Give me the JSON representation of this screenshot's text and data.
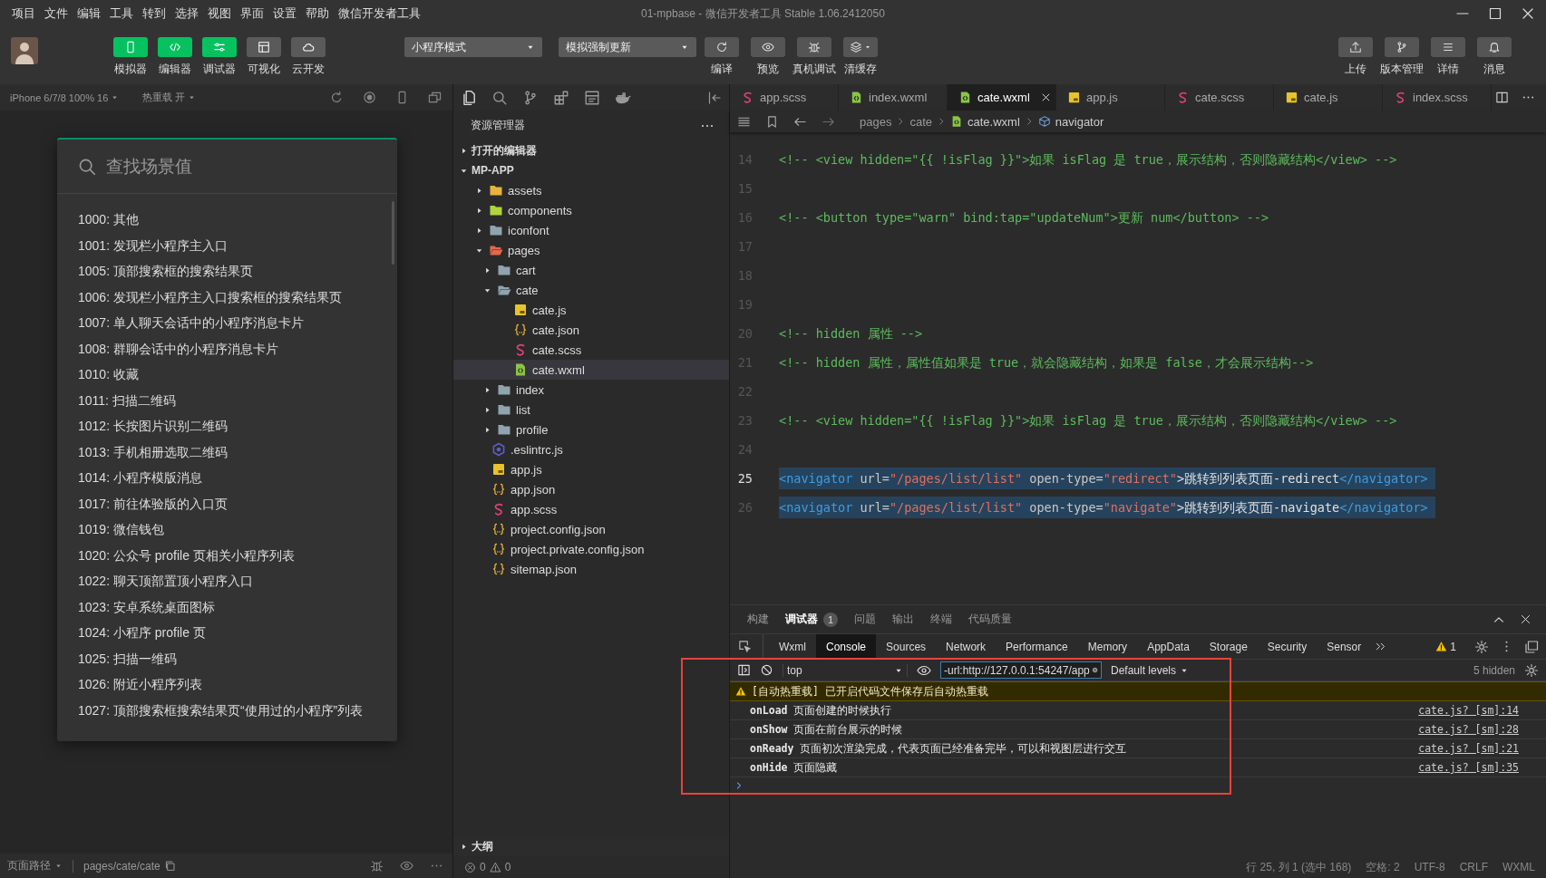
{
  "menu_bar": {
    "items": [
      "项目",
      "文件",
      "编辑",
      "工具",
      "转到",
      "选择",
      "视图",
      "界面",
      "设置",
      "帮助",
      "微信开发者工具"
    ]
  },
  "window": {
    "title": "01-mpbase - 微信开发者工具 Stable 1.06.2412050"
  },
  "toolbar": {
    "panel_toggles": [
      {
        "label": "模拟器",
        "selected": true
      },
      {
        "label": "编辑器",
        "selected": true
      },
      {
        "label": "调试器",
        "selected": true
      },
      {
        "label": "可视化",
        "selected": false
      },
      {
        "label": "云开发",
        "selected": false
      }
    ],
    "mode_select": "小程序模式",
    "compile_select": "模拟强制更新",
    "actions": [
      "编译",
      "预览",
      "真机调试",
      "清缓存"
    ],
    "right_actions": [
      "上传",
      "版本管理",
      "详情",
      "消息"
    ]
  },
  "simulator": {
    "device": "iPhone 6/7/8 100% 16",
    "hot_reload": "热重载 开",
    "search": {
      "placeholder": "查找场景值"
    },
    "scenes": [
      "1000: 其他",
      "1001: 发现栏小程序主入口",
      "1005: 顶部搜索框的搜索结果页",
      "1006: 发现栏小程序主入口搜索框的搜索结果页",
      "1007: 单人聊天会话中的小程序消息卡片",
      "1008: 群聊会话中的小程序消息卡片",
      "1010: 收藏",
      "1011: 扫描二维码",
      "1012: 长按图片识别二维码",
      "1013: 手机相册选取二维码",
      "1014: 小程序模版消息",
      "1017: 前往体验版的入口页",
      "1019: 微信钱包",
      "1020: 公众号 profile 页相关小程序列表",
      "1022: 聊天顶部置顶小程序入口",
      "1023: 安卓系统桌面图标",
      "1024: 小程序 profile 页",
      "1025: 扫描一维码",
      "1026: 附近小程序列表",
      "1027: 顶部搜索框搜索结果页“使用过的小程序”列表"
    ],
    "page_path": {
      "label": "页面路径",
      "path": "pages/cate/cate"
    }
  },
  "explorer": {
    "title": "资源管理器",
    "open_editors": {
      "label": "打开的编辑器",
      "expanded": false
    },
    "project": {
      "label": "MP-APP",
      "expanded": true,
      "children": [
        {
          "name": "assets",
          "kind": "folder",
          "color": "#e8b43c",
          "expanded": false,
          "selected": false
        },
        {
          "name": "components",
          "kind": "folder",
          "color": "#b4d23c",
          "expanded": false,
          "selected": false
        },
        {
          "name": "iconfont",
          "kind": "folder",
          "color": "#90a4ae",
          "expanded": false,
          "selected": false
        },
        {
          "name": "pages",
          "kind": "folder",
          "color": "#e2694a",
          "expanded": true,
          "selected": false,
          "children": [
            {
              "name": "cart",
              "kind": "folder",
              "color": "#90a4ae",
              "expanded": false,
              "selected": false
            },
            {
              "name": "cate",
              "kind": "folder",
              "color": "#90a4ae",
              "expanded": true,
              "selected": false,
              "children": [
                {
                  "name": "cate.js",
                  "kind": "js",
                  "selected": false
                },
                {
                  "name": "cate.json",
                  "kind": "json",
                  "selected": false
                },
                {
                  "name": "cate.scss",
                  "kind": "scss",
                  "selected": false
                },
                {
                  "name": "cate.wxml",
                  "kind": "wxml",
                  "selected": true
                }
              ]
            },
            {
              "name": "index",
              "kind": "folder",
              "color": "#90a4ae",
              "expanded": false,
              "selected": false
            },
            {
              "name": "list",
              "kind": "folder",
              "color": "#90a4ae",
              "expanded": false,
              "selected": false
            },
            {
              "name": "profile",
              "kind": "folder",
              "color": "#90a4ae",
              "expanded": false,
              "selected": false
            }
          ]
        },
        {
          "name": ".eslintrc.js",
          "kind": "eslint",
          "selected": false
        },
        {
          "name": "app.js",
          "kind": "js",
          "selected": false
        },
        {
          "name": "app.json",
          "kind": "json",
          "selected": false
        },
        {
          "name": "app.scss",
          "kind": "scss",
          "selected": false
        },
        {
          "name": "project.config.json",
          "kind": "json",
          "selected": false
        },
        {
          "name": "project.private.config.json",
          "kind": "json",
          "selected": false
        },
        {
          "name": "sitemap.json",
          "kind": "json",
          "selected": false
        }
      ]
    },
    "outline": {
      "label": "大纲",
      "expanded": false
    },
    "problems": {
      "errors": "0",
      "warnings": "0"
    }
  },
  "editor": {
    "tabs": [
      {
        "label": "app.scss",
        "kind": "scss",
        "selected": false
      },
      {
        "label": "index.wxml",
        "kind": "wxml",
        "selected": false
      },
      {
        "label": "cate.wxml",
        "kind": "wxml",
        "selected": true
      },
      {
        "label": "app.js",
        "kind": "js",
        "selected": false
      },
      {
        "label": "cate.scss",
        "kind": "scss",
        "selected": false
      },
      {
        "label": "cate.js",
        "kind": "js",
        "selected": false
      },
      {
        "label": "index.scss",
        "kind": "scss",
        "selected": false
      }
    ],
    "breadcrumb": [
      {
        "label": "pages",
        "kind": "folder"
      },
      {
        "label": "cate",
        "kind": "folder"
      },
      {
        "label": "cate.wxml",
        "kind": "wxml"
      },
      {
        "label": "navigator",
        "kind": "element"
      }
    ],
    "lines": [
      {
        "number": "14",
        "current": false,
        "selected": false,
        "tokens": [
          {
            "kind": "comment",
            "text": "<!-- <view hidden=\"{{ !isFlag }}\">如果 isFlag 是 true，展示结构，否则隐藏结构</view> -->"
          }
        ]
      },
      {
        "number": "15",
        "current": false,
        "selected": false
      },
      {
        "number": "16",
        "current": false,
        "selected": false,
        "tokens": [
          {
            "kind": "comment",
            "text": "<!-- <button type=\"warn\" bind:tap=\"updateNum\">更新 num</button> -->"
          }
        ]
      },
      {
        "number": "17",
        "current": false,
        "selected": false
      },
      {
        "number": "18",
        "current": false,
        "selected": false
      },
      {
        "number": "19",
        "current": false,
        "selected": false
      },
      {
        "number": "20",
        "current": false,
        "selected": false,
        "tokens": [
          {
            "kind": "comment",
            "text": "<!-- hidden 属性 -->"
          }
        ]
      },
      {
        "number": "21",
        "current": false,
        "selected": false,
        "tokens": [
          {
            "kind": "comment",
            "text": "<!-- hidden 属性，属性值如果是 true，就会隐藏结构，如果是 false，才会展示结构-->"
          }
        ]
      },
      {
        "number": "22",
        "current": false,
        "selected": false
      },
      {
        "number": "23",
        "current": false,
        "selected": false,
        "tokens": [
          {
            "kind": "comment",
            "text": "<!-- <view hidden=\"{{ !isFlag }}\">如果 isFlag 是 true，展示结构，否则隐藏结构</view> -->"
          }
        ]
      },
      {
        "number": "24",
        "current": false,
        "selected": false
      },
      {
        "number": "25",
        "current": true,
        "selected": true,
        "tokens": [
          {
            "kind": "tag",
            "text": "<navigator"
          },
          {
            "kind": "attr",
            "text": " url="
          },
          {
            "kind": "string",
            "text": "\"/pages/list/list\""
          },
          {
            "kind": "attr",
            "text": " open-type="
          },
          {
            "kind": "string",
            "text": "\"redirect\""
          },
          {
            "kind": "text",
            "text": ">跳转到列表页面-redirect"
          },
          {
            "kind": "tag",
            "text": "</navigator>"
          }
        ]
      },
      {
        "number": "26",
        "current": false,
        "selected": true,
        "tokens": [
          {
            "kind": "tag",
            "text": "<navigator"
          },
          {
            "kind": "attr",
            "text": " url="
          },
          {
            "kind": "string",
            "text": "\"/pages/list/list\""
          },
          {
            "kind": "attr",
            "text": " open-type="
          },
          {
            "kind": "string",
            "text": "\"navigate\""
          },
          {
            "kind": "text",
            "text": ">跳转到列表页面-navigate"
          },
          {
            "kind": "tag",
            "text": "</navigator>"
          }
        ]
      }
    ]
  },
  "panel": {
    "tabs": [
      {
        "label": "构建",
        "selected": false
      },
      {
        "label": "调试器",
        "selected": true,
        "badge": "1"
      },
      {
        "label": "问题",
        "selected": false
      },
      {
        "label": "输出",
        "selected": false
      },
      {
        "label": "终端",
        "selected": false
      },
      {
        "label": "代码质量",
        "selected": false
      }
    ],
    "devtools": {
      "tabs": [
        {
          "label": "Wxml",
          "selected": false
        },
        {
          "label": "Console",
          "selected": true
        },
        {
          "label": "Sources",
          "selected": false
        },
        {
          "label": "Network",
          "selected": false
        },
        {
          "label": "Performance",
          "selected": false
        },
        {
          "label": "Memory",
          "selected": false
        },
        {
          "label": "AppData",
          "selected": false
        },
        {
          "label": "Storage",
          "selected": false
        },
        {
          "label": "Security",
          "selected": false
        },
        {
          "label": "Sensor",
          "selected": false
        }
      ],
      "warnings": "1"
    },
    "console": {
      "context": "top",
      "filter": "-url:http://127.0.0.1:54247/app",
      "levels": "Default levels",
      "hidden": "5 hidden",
      "messages": [
        {
          "kind": "warning",
          "text": "[自动热重载] 已开启代码文件保存后自动热重载"
        },
        {
          "kind": "log",
          "text": "**onLoad** 页面创建的时候执行",
          "source": "cate.js? [sm]:14"
        },
        {
          "kind": "log",
          "text": "**onShow** 页面在前台展示的时候",
          "source": "cate.js? [sm]:28"
        },
        {
          "kind": "log",
          "text": "**onReady** 页面初次渲染完成，代表页面已经准备完毕，可以和视图层进行交互",
          "source": "cate.js? [sm]:21"
        },
        {
          "kind": "log",
          "text": "**onHide** 页面隐藏",
          "source": "cate.js? [sm]:35"
        }
      ]
    }
  },
  "status_bar": {
    "items": [
      "行 25, 列 1 (选中 168)",
      "空格: 2",
      "UTF-8",
      "CRLF",
      "WXML"
    ]
  }
}
